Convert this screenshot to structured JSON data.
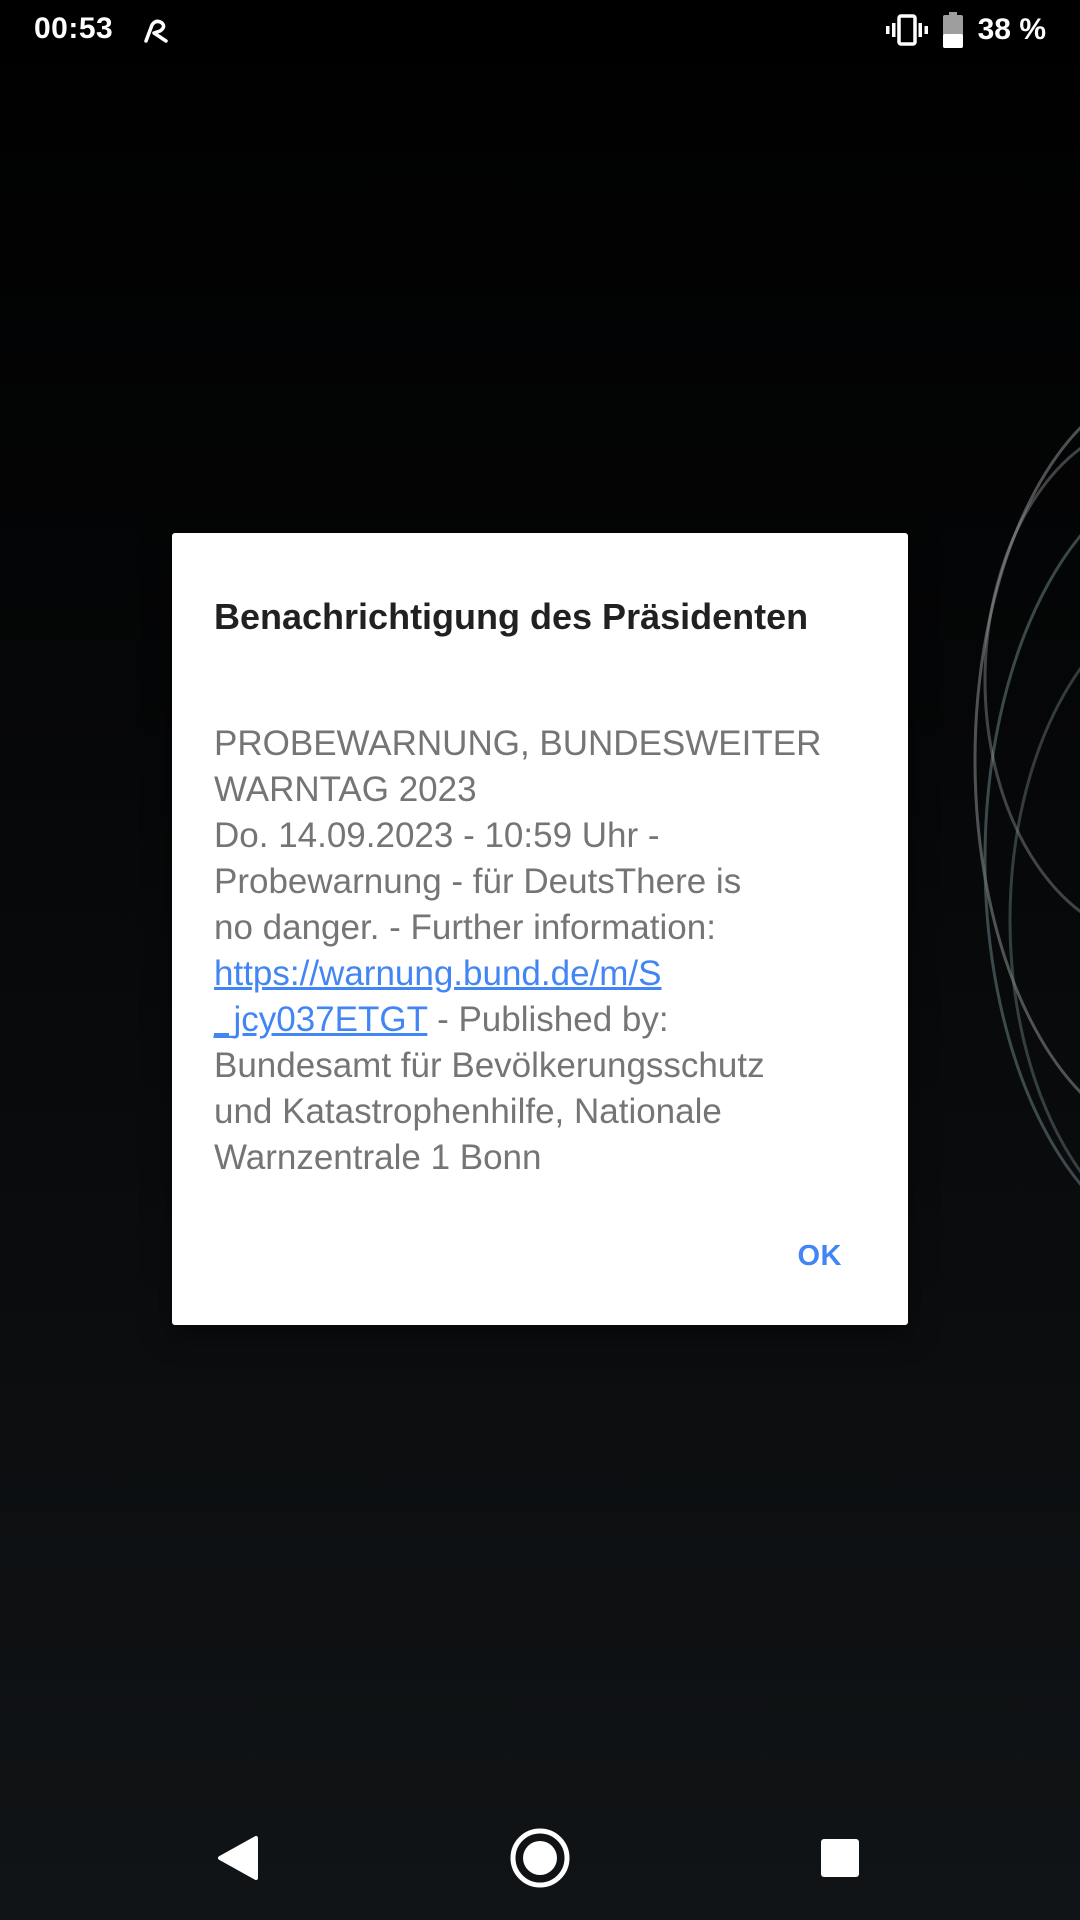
{
  "status_bar": {
    "time": "00:53",
    "battery_percent": "38 %",
    "icons": [
      "app-notification-icon",
      "vibrate-icon",
      "battery-icon"
    ]
  },
  "dialog": {
    "title": "Benachrichtigung des Präsidenten",
    "body_lines": [
      "PROBEWARNUNG, BUNDESWEITER",
      "WARNTAG 2023",
      "Do. 14.09.2023 - 10:59 Uhr -",
      "Probewarnung - für DeutsThere is",
      "no danger. - Further information:"
    ],
    "link_line1": "https://warnung.bund.de/m/S",
    "link_line2": "_jcy037ETGT",
    "after_link": " - Published by:",
    "tail_lines": [
      "Bundesamt für Bevölkerungsschutz",
      "und Katastrophenhilfe, Nationale",
      "Warnzentrale 1 Bonn"
    ],
    "ok_label": "OK"
  },
  "nav_bar": {
    "buttons": [
      "back-icon",
      "home-icon",
      "recents-icon"
    ]
  },
  "colors": {
    "accent": "#4285f4",
    "title": "#212121",
    "body": "#757575",
    "dialog_bg": "#ffffff"
  }
}
